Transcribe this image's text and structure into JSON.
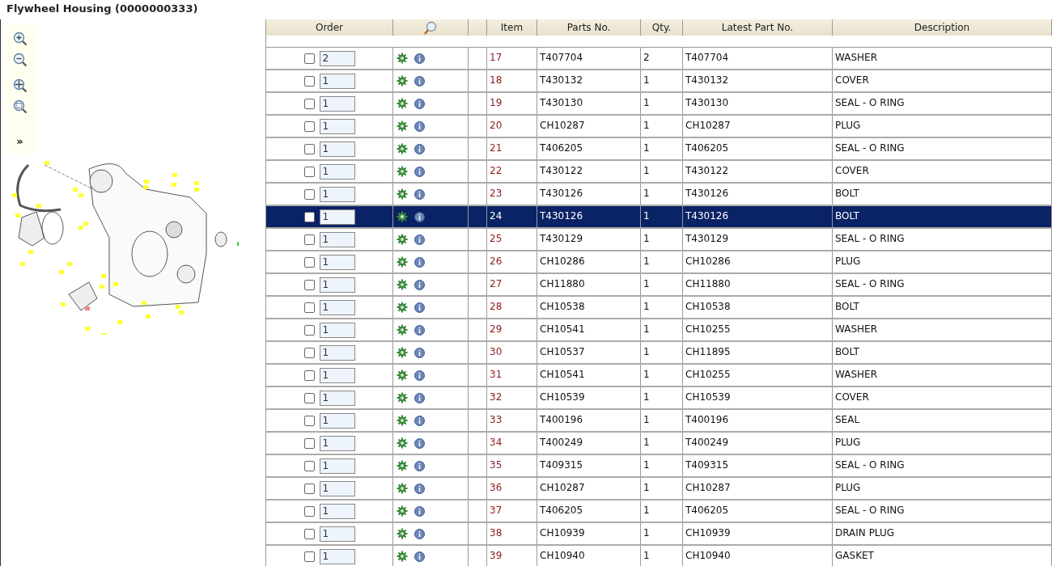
{
  "title": "Flywheel Housing (0000000333)",
  "toolbar": {
    "expand": "»"
  },
  "table": {
    "columns": [
      "Order",
      "",
      "Item",
      "Parts No.",
      "Qty.",
      "Latest Part No.",
      "Description"
    ],
    "rows": [
      {
        "checked": false,
        "order": "2",
        "item": "17",
        "part_no": "T407704",
        "qty": "2",
        "latest": "T407704",
        "description": "WASHER",
        "selected": false
      },
      {
        "checked": false,
        "order": "1",
        "item": "18",
        "part_no": "T430132",
        "qty": "1",
        "latest": "T430132",
        "description": "COVER",
        "selected": false
      },
      {
        "checked": false,
        "order": "1",
        "item": "19",
        "part_no": "T430130",
        "qty": "1",
        "latest": "T430130",
        "description": "SEAL - O RING",
        "selected": false
      },
      {
        "checked": false,
        "order": "1",
        "item": "20",
        "part_no": "CH10287",
        "qty": "1",
        "latest": "CH10287",
        "description": "PLUG",
        "selected": false
      },
      {
        "checked": false,
        "order": "1",
        "item": "21",
        "part_no": "T406205",
        "qty": "1",
        "latest": "T406205",
        "description": "SEAL - O RING",
        "selected": false
      },
      {
        "checked": false,
        "order": "1",
        "item": "22",
        "part_no": "T430122",
        "qty": "1",
        "latest": "T430122",
        "description": "COVER",
        "selected": false
      },
      {
        "checked": false,
        "order": "1",
        "item": "23",
        "part_no": "T430126",
        "qty": "1",
        "latest": "T430126",
        "description": "BOLT",
        "selected": false
      },
      {
        "checked": false,
        "order": "1",
        "item": "24",
        "part_no": "T430126",
        "qty": "1",
        "latest": "T430126",
        "description": "BOLT",
        "selected": true
      },
      {
        "checked": false,
        "order": "1",
        "item": "25",
        "part_no": "T430129",
        "qty": "1",
        "latest": "T430129",
        "description": "SEAL - O RING",
        "selected": false
      },
      {
        "checked": false,
        "order": "1",
        "item": "26",
        "part_no": "CH10286",
        "qty": "1",
        "latest": "CH10286",
        "description": "PLUG",
        "selected": false
      },
      {
        "checked": false,
        "order": "1",
        "item": "27",
        "part_no": "CH11880",
        "qty": "1",
        "latest": "CH11880",
        "description": "SEAL - O RING",
        "selected": false
      },
      {
        "checked": false,
        "order": "1",
        "item": "28",
        "part_no": "CH10538",
        "qty": "1",
        "latest": "CH10538",
        "description": "BOLT",
        "selected": false
      },
      {
        "checked": false,
        "order": "1",
        "item": "29",
        "part_no": "CH10541",
        "qty": "1",
        "latest": "CH10255",
        "description": "WASHER",
        "selected": false
      },
      {
        "checked": false,
        "order": "1",
        "item": "30",
        "part_no": "CH10537",
        "qty": "1",
        "latest": "CH11895",
        "description": "BOLT",
        "selected": false
      },
      {
        "checked": false,
        "order": "1",
        "item": "31",
        "part_no": "CH10541",
        "qty": "1",
        "latest": "CH10255",
        "description": "WASHER",
        "selected": false
      },
      {
        "checked": false,
        "order": "1",
        "item": "32",
        "part_no": "CH10539",
        "qty": "1",
        "latest": "CH10539",
        "description": "COVER",
        "selected": false
      },
      {
        "checked": false,
        "order": "1",
        "item": "33",
        "part_no": "T400196",
        "qty": "1",
        "latest": "T400196",
        "description": "SEAL",
        "selected": false
      },
      {
        "checked": false,
        "order": "1",
        "item": "34",
        "part_no": "T400249",
        "qty": "1",
        "latest": "T400249",
        "description": "PLUG",
        "selected": false
      },
      {
        "checked": false,
        "order": "1",
        "item": "35",
        "part_no": "T409315",
        "qty": "1",
        "latest": "T409315",
        "description": "SEAL - O RING",
        "selected": false
      },
      {
        "checked": false,
        "order": "1",
        "item": "36",
        "part_no": "CH10287",
        "qty": "1",
        "latest": "CH10287",
        "description": "PLUG",
        "selected": false
      },
      {
        "checked": false,
        "order": "1",
        "item": "37",
        "part_no": "T406205",
        "qty": "1",
        "latest": "T406205",
        "description": "SEAL - O RING",
        "selected": false
      },
      {
        "checked": false,
        "order": "1",
        "item": "38",
        "part_no": "CH10939",
        "qty": "1",
        "latest": "CH10939",
        "description": "DRAIN PLUG",
        "selected": false
      },
      {
        "checked": false,
        "order": "1",
        "item": "39",
        "part_no": "CH10940",
        "qty": "1",
        "latest": "CH10940",
        "description": "GASKET",
        "selected": false
      }
    ]
  }
}
